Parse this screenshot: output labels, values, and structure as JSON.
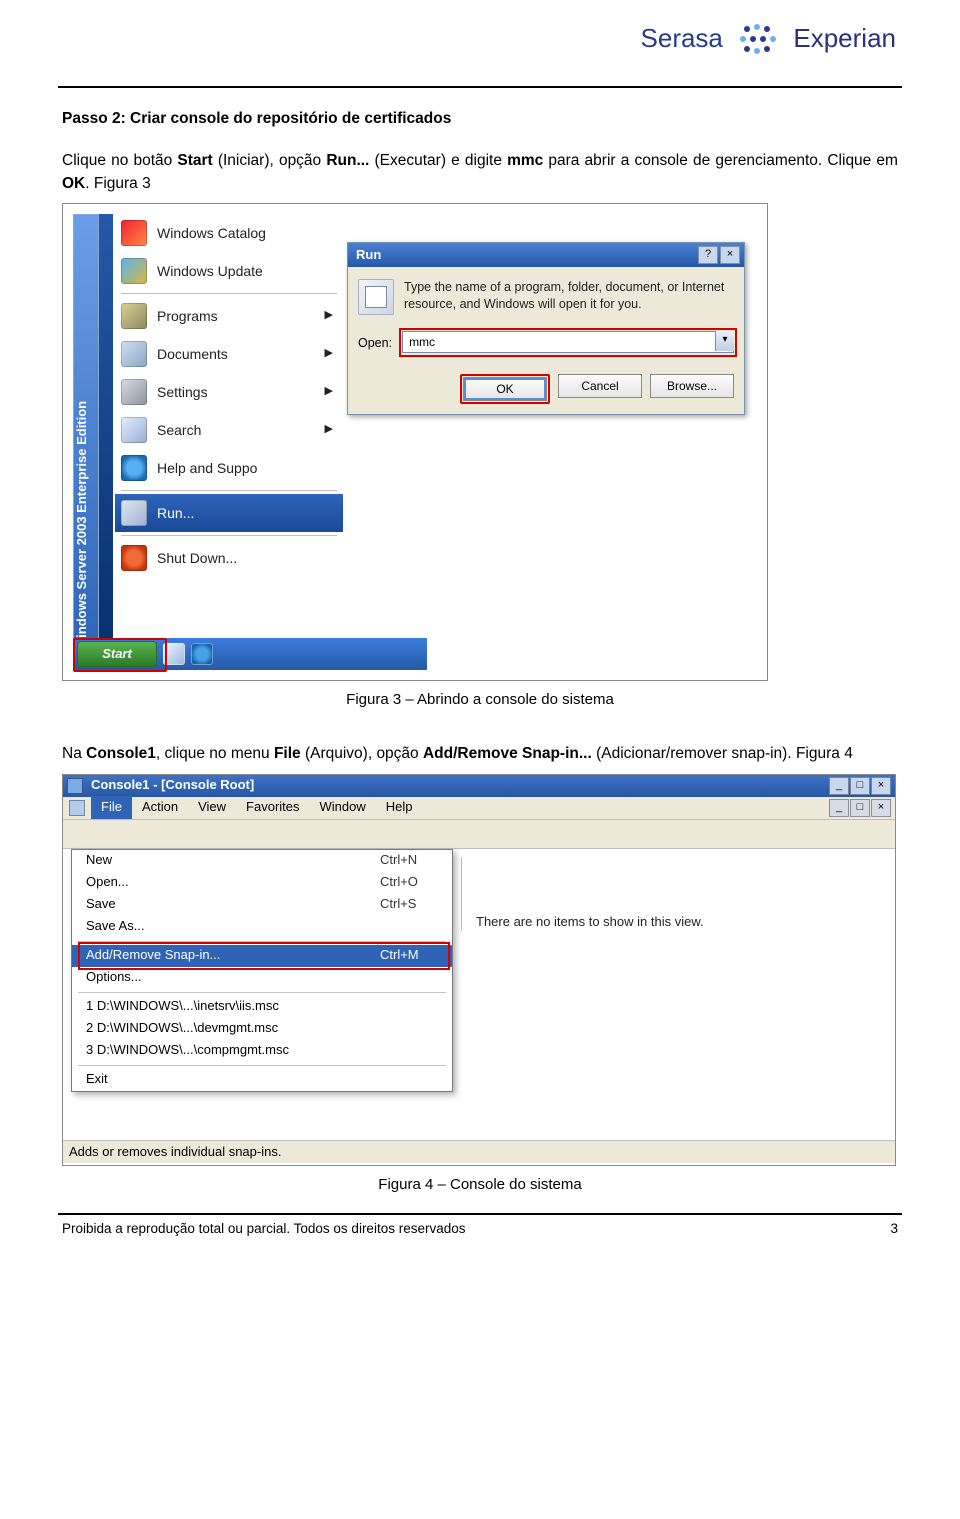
{
  "logo": {
    "s": "Serasa",
    "e": "Experian"
  },
  "heading": "Passo 2: Criar console do repositório de certificados",
  "para1_a": "Clique no botão ",
  "para1_b": "Start",
  "para1_c": " (Iniciar), opção ",
  "para1_d": "Run...",
  "para1_e": " (Executar) e digite ",
  "para1_f": "mmc",
  "para1_g": " para abrir a console de gerenciamento. Clique em ",
  "para1_h": "OK",
  "para1_i": ". Figura 3",
  "ss1": {
    "banner": "Windows Server 2003  Enterprise Edition",
    "menu": [
      "Windows Catalog",
      "Windows Update",
      "Programs",
      "Documents",
      "Settings",
      "Search",
      "Help and Suppo",
      "Run...",
      "Shut Down..."
    ],
    "seps": [
      1,
      6,
      7
    ],
    "highlight_index": 7,
    "start": "Start",
    "run": {
      "title": "Run",
      "help_btn": "?",
      "close_btn": "×",
      "text": "Type the name of a program, folder, document, or Internet resource, and Windows will open it for you.",
      "open_label": "Open:",
      "open_value": "mmc",
      "dd": "▾",
      "ok": "OK",
      "cancel": "Cancel",
      "browse": "Browse..."
    }
  },
  "caption1": "Figura 3 – Abrindo a console do sistema",
  "para2_a": "Na ",
  "para2_b": "Console1",
  "para2_c": ", clique no menu ",
  "para2_d": "File",
  "para2_e": " (Arquivo), opção ",
  "para2_f": "Add/Remove Snap-in...",
  "para2_g": " (Adicionar/remover snap-in). Figura 4",
  "ss2": {
    "title": "Console1 - [Console Root]",
    "win_min": "_",
    "win_max": "□",
    "win_close": "×",
    "menus": [
      "File",
      "Action",
      "View",
      "Favorites",
      "Window",
      "Help"
    ],
    "mdi_min": "_",
    "mdi_max": "□",
    "mdi_close": "×",
    "file_menu": [
      {
        "l": "New",
        "r": "Ctrl+N"
      },
      {
        "l": "Open...",
        "r": "Ctrl+O"
      },
      {
        "l": "Save",
        "r": "Ctrl+S"
      },
      {
        "l": "Save As...",
        "r": ""
      },
      {
        "sep": true
      },
      {
        "l": "Add/Remove Snap-in...",
        "r": "Ctrl+M",
        "on": true
      },
      {
        "l": "Options...",
        "r": ""
      },
      {
        "sep": true
      },
      {
        "l": "1 D:\\WINDOWS\\...\\inetsrv\\iis.msc",
        "r": ""
      },
      {
        "l": "2 D:\\WINDOWS\\...\\devmgmt.msc",
        "r": ""
      },
      {
        "l": "3 D:\\WINDOWS\\...\\compmgmt.msc",
        "r": ""
      },
      {
        "sep": true
      },
      {
        "l": "Exit",
        "r": ""
      }
    ],
    "content_msg": "There are no items to show in this view.",
    "status": "Adds or removes individual snap-ins."
  },
  "caption2": "Figura 4 – Console do sistema",
  "footer_left": "Proibida a reprodução total ou parcial. Todos os direitos reservados",
  "footer_right": "3"
}
